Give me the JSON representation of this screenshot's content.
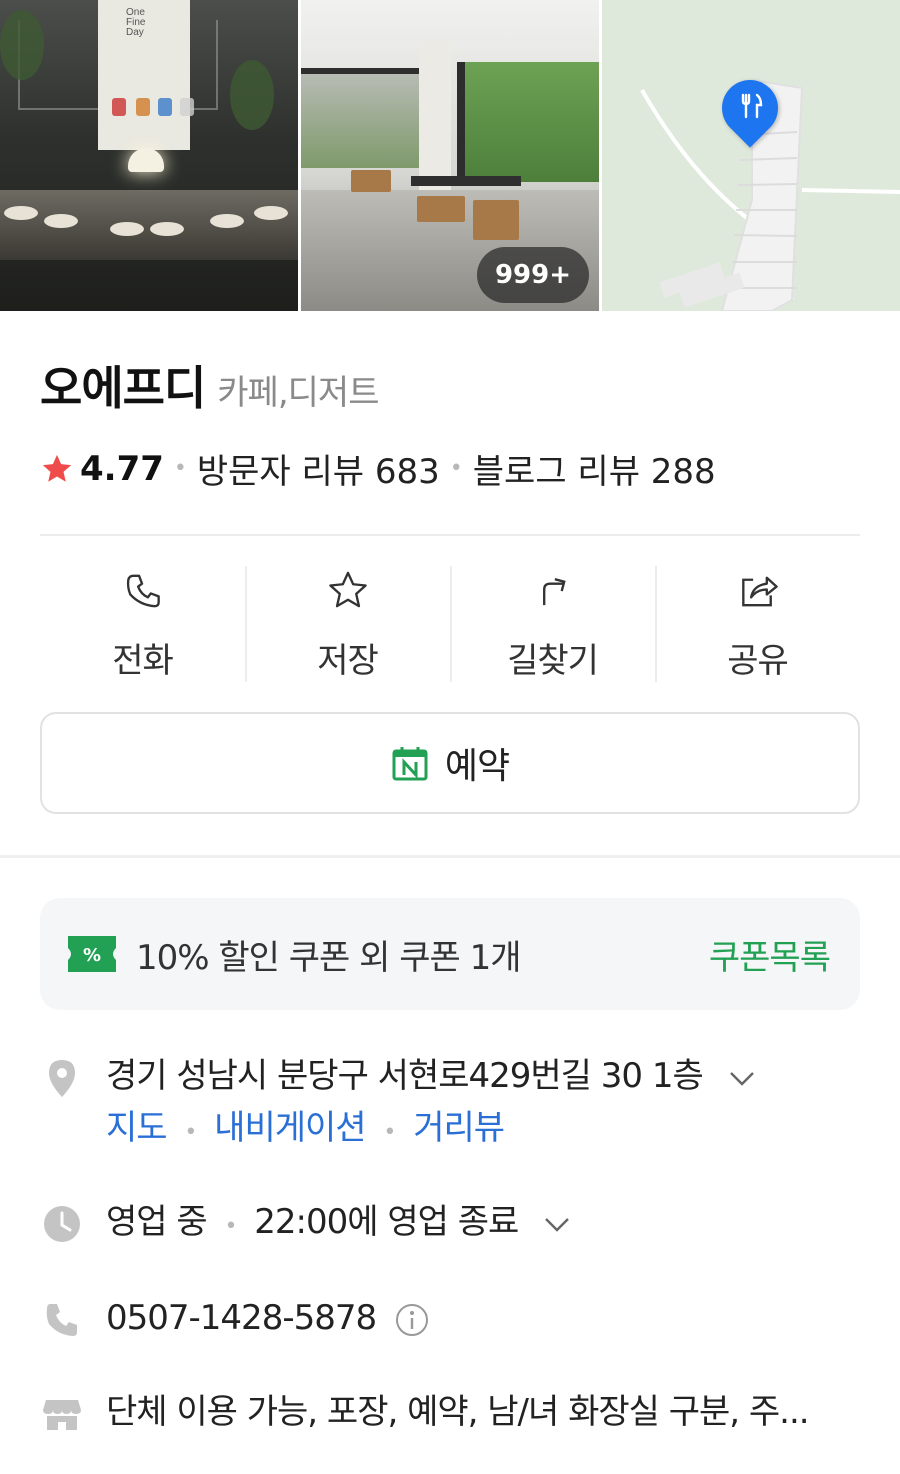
{
  "photos": {
    "poster_text": "One Fine Day",
    "more_count": "999+"
  },
  "place": {
    "name": "오에프디",
    "category": "카페,디저트"
  },
  "rating": {
    "score": "4.77",
    "visitor_reviews": "방문자 리뷰 683",
    "blog_reviews": "블로그 리뷰 288"
  },
  "actions": [
    {
      "label": "전화",
      "icon": "phone-icon"
    },
    {
      "label": "저장",
      "icon": "star-outline-icon"
    },
    {
      "label": "길찾기",
      "icon": "directions-icon"
    },
    {
      "label": "공유",
      "icon": "share-icon"
    }
  ],
  "reserve": {
    "label": "예약",
    "icon": "naver-calendar-icon"
  },
  "coupon": {
    "text": "10% 할인 쿠폰 외 쿠폰 1개",
    "link": "쿠폰목록",
    "icon_text": "%"
  },
  "address": {
    "text": "경기 성남시 분당구 서현로429번길 30 1층",
    "links": [
      "지도",
      "내비게이션",
      "거리뷰"
    ]
  },
  "hours": {
    "status": "영업 중",
    "detail": "22:00에 영업 종료"
  },
  "phone": {
    "number": "0507-1428-5878"
  },
  "amenities": {
    "text": "단체 이용 가능, 포장, 예약, 남/녀 화장실 구분, 주..."
  },
  "colors": {
    "accent_green": "#22a053",
    "link_blue": "#2a6fd6",
    "star_red": "#f04b4b",
    "pin_blue": "#1d76f0"
  }
}
